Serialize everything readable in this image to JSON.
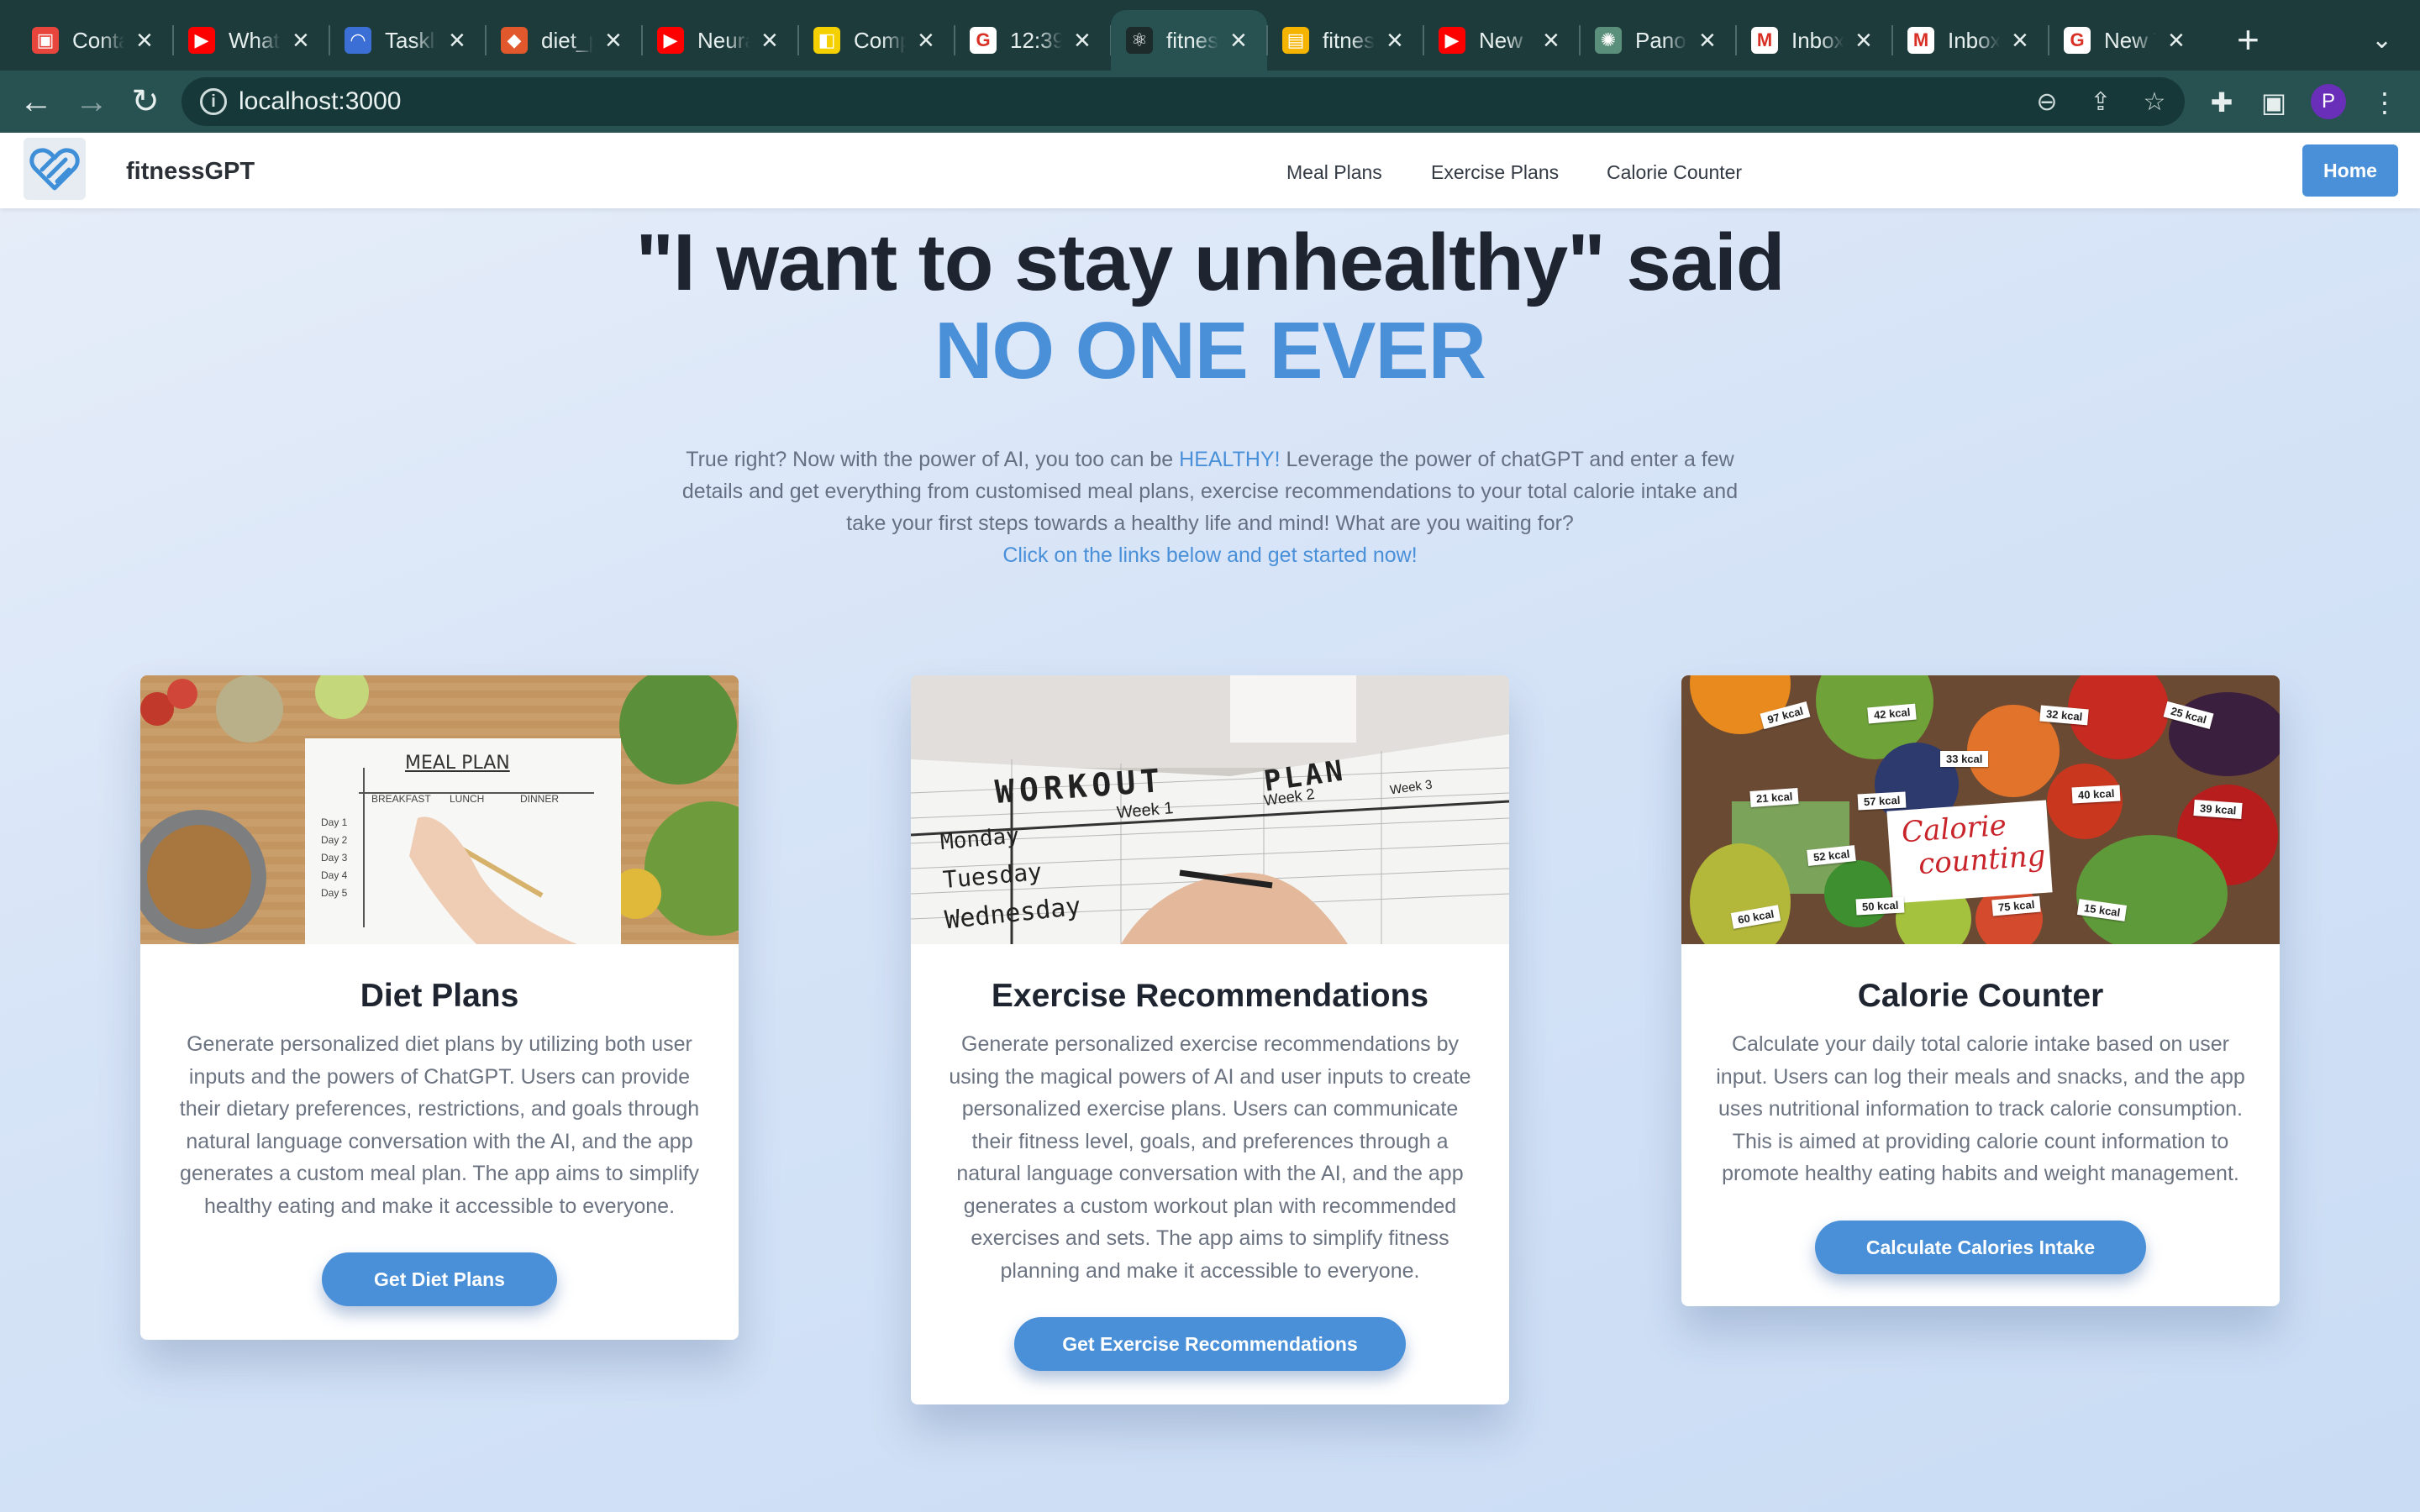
{
  "browser": {
    "tabs": [
      {
        "title": "Contacts",
        "color": "#e8453c",
        "glyph": "▣"
      },
      {
        "title": "What",
        "color": "#ff0000",
        "glyph": "▶"
      },
      {
        "title": "Tasklist",
        "color": "#3b6fd6",
        "glyph": "◠"
      },
      {
        "title": "diet_planner",
        "color": "#e2582d",
        "glyph": "◆"
      },
      {
        "title": "Neural",
        "color": "#ff0000",
        "glyph": "▶"
      },
      {
        "title": "Comp",
        "color": "#f5d000",
        "glyph": "◧"
      },
      {
        "title": "12:39",
        "color": "#ffffff",
        "glyph": "G"
      },
      {
        "title": "fitnessGPT",
        "color": "#1d2b2b",
        "glyph": "⚛"
      },
      {
        "title": "fitness",
        "color": "#f4b400",
        "glyph": "▤"
      },
      {
        "title": "New",
        "color": "#ff0000",
        "glyph": "▶"
      },
      {
        "title": "Panorama",
        "color": "#5a8f7b",
        "glyph": "✺"
      },
      {
        "title": "Inbox",
        "color": "#ffffff",
        "glyph": "M"
      },
      {
        "title": "Inbox",
        "color": "#ffffff",
        "glyph": "M"
      },
      {
        "title": "New Tab",
        "color": "#ffffff",
        "glyph": "G"
      }
    ],
    "active_tab_index": 7,
    "new_tab_glyph": "+",
    "url": "localhost:3000",
    "profile_initial": "P"
  },
  "site": {
    "brand": "fitnessGPT",
    "nav": [
      "Meal Plans",
      "Exercise Plans",
      "Calorie Counter"
    ],
    "home_button": "Home"
  },
  "hero": {
    "headline": "\"I want to stay unhealthy\" said",
    "headline_accent": "NO ONE EVER",
    "intro_part1": "True right? Now with the power of AI, you too can be ",
    "intro_highlight": "HEALTHY!",
    "intro_part2": " Leverage the power of chatGPT and enter a few details and get everything from customised meal plans, exercise recommendations to your total calorie intake and take your first steps towards a healthy life and mind! What are you waiting for?",
    "intro_cta": "Click on the links below and get started now!"
  },
  "cards": [
    {
      "title": "Diet Plans",
      "text": "Generate personalized diet plans by utilizing both user inputs and the powers of ChatGPT. Users can provide their dietary preferences, restrictions, and goals through natural language conversation with the AI, and the app generates a custom meal plan. The app aims to simplify healthy eating and make it accessible to everyone.",
      "button": "Get Diet Plans",
      "image": {
        "heading": "MEAL PLAN",
        "columns": [
          "BREAKFAST",
          "LUNCH",
          "DINNER"
        ],
        "rows": [
          "Day 1",
          "Day 2",
          "Day 3",
          "Day 4",
          "Day 5"
        ]
      }
    },
    {
      "title": "Exercise Recommendations",
      "text": "Generate personalized exercise recommendations by using the magical powers of AI and user inputs to create personalized exercise plans. Users can communicate their fitness level, goals, and preferences through a natural language conversation with the AI, and the app generates a custom workout plan with recommended exercises and sets. The app aims to simplify fitness planning and make it accessible to everyone.",
      "button": "Get Exercise Recommendations",
      "image": {
        "word1": "WORKOUT",
        "word2": "PLAN",
        "weeks": [
          "Week 1",
          "Week 2",
          "Week 3"
        ],
        "days": [
          "Monday",
          "Tuesday",
          "Wednesday"
        ]
      }
    },
    {
      "title": "Calorie Counter",
      "text": "Calculate your daily total calorie intake based on user input. Users can log their meals and snacks, and the app uses nutritional information to track calorie consumption. This is aimed at providing calorie count information to promote healthy eating habits and weight management.",
      "button": "Calculate Calories Intake",
      "image": {
        "label1": "Calorie",
        "label2": "counting",
        "kcal": [
          "97 kcal",
          "42 kcal",
          "32 kcal",
          "25 kcal",
          "33 kcal",
          "21 kcal",
          "57 kcal",
          "40 kcal",
          "39 kcal",
          "52 kcal",
          "50 kcal",
          "75 kcal",
          "15 kcal",
          "60 kcal"
        ]
      }
    }
  ]
}
